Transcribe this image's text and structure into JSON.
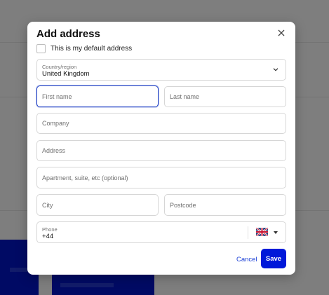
{
  "modal": {
    "title": "Add address",
    "default_checkbox_label": "This is my default address",
    "country": {
      "label": "Country/region",
      "value": "United Kingdom"
    },
    "fields": {
      "first_name_placeholder": "First name",
      "last_name_placeholder": "Last name",
      "company_placeholder": "Company",
      "address_placeholder": "Address",
      "apartment_placeholder": "Apartment, suite, etc (optional)",
      "city_placeholder": "City",
      "postcode_placeholder": "Postcode"
    },
    "phone": {
      "label": "Phone",
      "value": "+44",
      "flag": "uk-flag-icon"
    },
    "cancel_label": "Cancel",
    "save_label": "Save"
  },
  "colors": {
    "accent": "#0018d9",
    "focus_border": "#1e3fc4",
    "overlay": "rgba(0,0,0,0.5)"
  }
}
